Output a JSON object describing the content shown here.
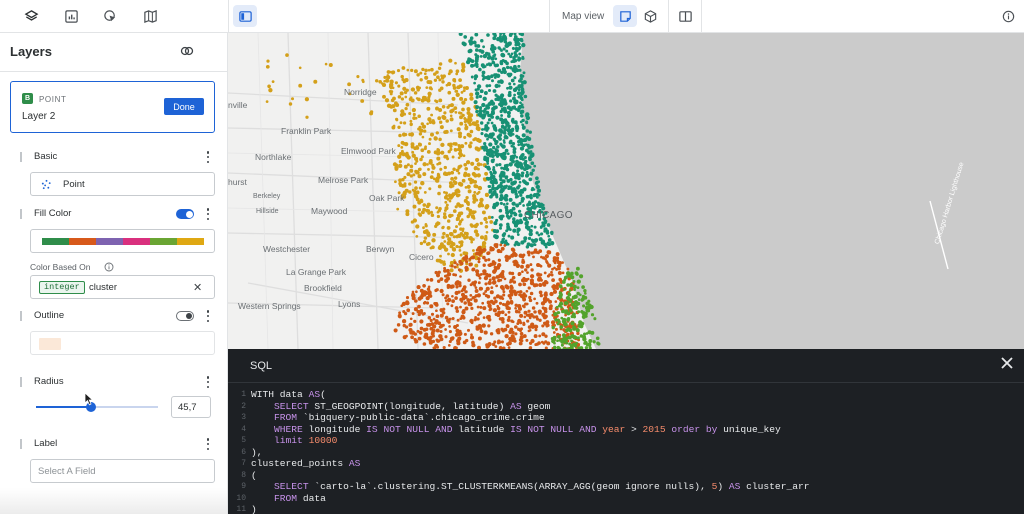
{
  "toolbar": {
    "map_view_label": "Map view",
    "icons": [
      "layers-icon",
      "widgets-icon",
      "interactions-icon",
      "basemap-icon",
      "panel-toggle-icon",
      "2d-view-icon",
      "3d-view-icon",
      "split-view-icon",
      "info-icon"
    ]
  },
  "sidebar": {
    "title": "Layers",
    "layer": {
      "badge": "B",
      "type": "POINT",
      "name": "Layer 2",
      "done_label": "Done"
    },
    "basic": {
      "label": "Basic",
      "value": "Point"
    },
    "fill_color": {
      "label": "Fill Color",
      "enabled": true,
      "palette": [
        "#2f8d4a",
        "#d7591b",
        "#7e63b0",
        "#d9307e",
        "#6aa533",
        "#dfa813"
      ],
      "color_based_on_label": "Color Based On",
      "type_chip": "integer",
      "field": "cluster"
    },
    "outline": {
      "label": "Outline",
      "enabled": false,
      "color": "#fbe8d8"
    },
    "radius": {
      "label": "Radius",
      "value": "45,7",
      "slider_fraction": 0.45
    },
    "label_section": {
      "label": "Label",
      "placeholder": "Select A Field"
    }
  },
  "map": {
    "labels": [
      "nville",
      "Norridge",
      "Franklin Park",
      "Elmwood Park",
      "Northlake",
      "hurst",
      "Melrose Park",
      "Oak Park",
      "Berkeley",
      "Hillside",
      "Maywood",
      "CHICAGO",
      "Westchester",
      "Berwyn",
      "Cicero",
      "La Grange Park",
      "Brookfield",
      "Western Springs",
      "Lyons",
      "Chicago Harbor Lighthouse"
    ],
    "cluster_colors": {
      "gold": "#d4a01a",
      "green": "#179174",
      "orange": "#cf5a16",
      "lime": "#53a32c"
    }
  },
  "sql": {
    "title": "SQL",
    "line_numbers": [
      "1",
      "2",
      "3",
      "4",
      "5",
      "6",
      "7",
      "8",
      "9",
      "10",
      "11"
    ]
  }
}
